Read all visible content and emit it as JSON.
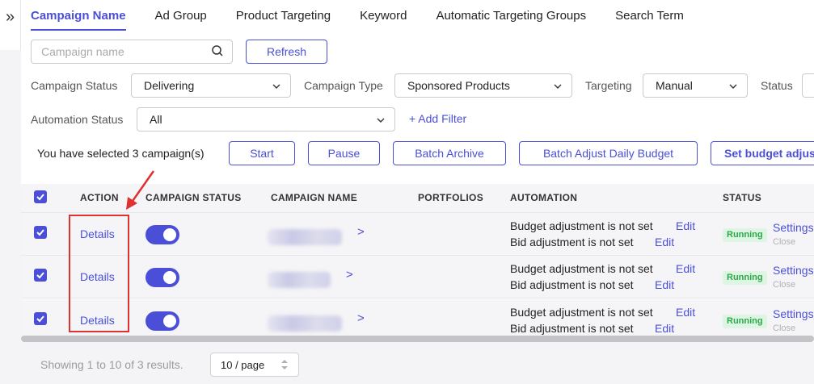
{
  "sidebar_toggle": {
    "glyph": "»"
  },
  "tabs": [
    {
      "label": "Campaign Name",
      "active": true
    },
    {
      "label": "Ad Group",
      "active": false
    },
    {
      "label": "Product Targeting",
      "active": false
    },
    {
      "label": "Keyword",
      "active": false
    },
    {
      "label": "Automatic Targeting Groups",
      "active": false
    },
    {
      "label": "Search Term",
      "active": false
    }
  ],
  "search": {
    "placeholder": "Campaign name",
    "icon": "search-icon"
  },
  "refresh_label": "Refresh",
  "filters": {
    "campaign_status": {
      "label": "Campaign Status",
      "value": "Delivering"
    },
    "campaign_type": {
      "label": "Campaign Type",
      "value": "Sponsored Products"
    },
    "targeting": {
      "label": "Targeting",
      "value": "Manual"
    },
    "status": {
      "label": "Status",
      "value": ""
    },
    "automation_status": {
      "label": "Automation Status",
      "value": "All"
    },
    "add_filter": "+ Add Filter"
  },
  "selection": {
    "text": "You have selected 3 campaign(s)",
    "buttons": [
      "Start",
      "Pause",
      "Batch Archive",
      "Batch Adjust Daily Budget",
      "Set budget adjus"
    ]
  },
  "table": {
    "columns": [
      "ACTION",
      "CAMPAIGN STATUS",
      "CAMPAIGN NAME",
      "PORTFOLIOS",
      "AUTOMATION",
      "STATUS"
    ],
    "rows": [
      {
        "checked": true,
        "action": "Details",
        "enabled": true,
        "campaign_name": "",
        "budget_text": "Budget adjustment is not set",
        "bid_text": "Bid adjustment is not set",
        "edit": "Edit",
        "status": "Running",
        "settings": "Settings",
        "close": "Close"
      },
      {
        "checked": true,
        "action": "Details",
        "enabled": true,
        "campaign_name": "",
        "budget_text": "Budget adjustment is not set",
        "bid_text": "Bid adjustment is not set",
        "edit": "Edit",
        "status": "Running",
        "settings": "Settings",
        "close": "Close"
      },
      {
        "checked": true,
        "action": "Details",
        "enabled": true,
        "campaign_name": "",
        "budget_text": "Budget adjustment is not set",
        "bid_text": "Bid adjustment is not set",
        "edit": "Edit",
        "status": "Running",
        "settings": "Settings",
        "close": "Close"
      }
    ]
  },
  "footer": {
    "showing": "Showing 1 to 10 of 3 results.",
    "page_size": "10 / page"
  },
  "colors": {
    "accent": "#4b4fd8",
    "running_bg": "#dff5e3",
    "running_text": "#2aa84a",
    "annotation": "#e03030"
  }
}
